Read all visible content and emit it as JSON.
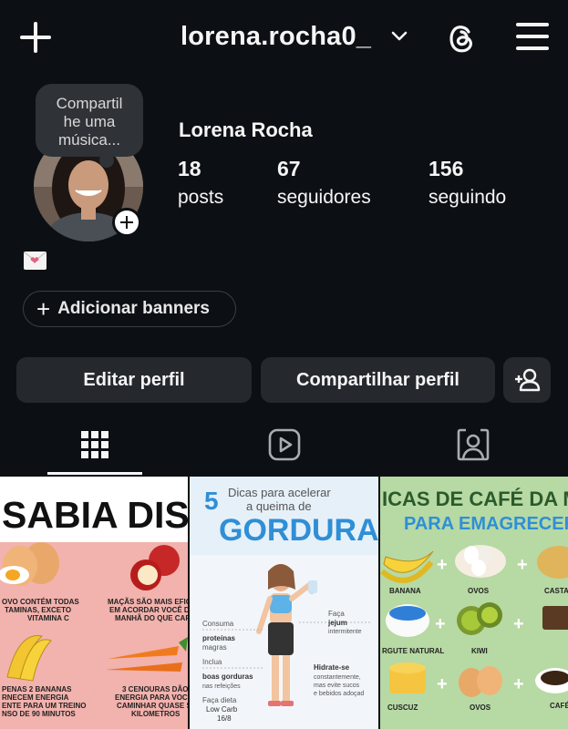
{
  "header": {
    "username": "lorena.rocha0_",
    "icons": [
      "plus-icon",
      "chevron-down-icon",
      "threads-icon",
      "menu-icon"
    ]
  },
  "profile": {
    "note": "Compartilhe uma música...",
    "note_line1": "Compartil",
    "note_line2": "he uma",
    "note_line3": "música...",
    "name": "Lorena Rocha",
    "stats": [
      {
        "value": "18",
        "label": "posts"
      },
      {
        "value": "67",
        "label": "seguidores"
      },
      {
        "value": "156",
        "label": "seguindo"
      }
    ],
    "bio_emoji": "envelope-with-heart"
  },
  "actions": {
    "banners": "Adicionar banners",
    "edit": "Editar perfil",
    "share": "Compartilhar perfil"
  },
  "tabs": [
    {
      "name": "grid",
      "active": true
    },
    {
      "name": "reels",
      "active": false
    },
    {
      "name": "tagged",
      "active": false
    }
  ],
  "posts": {
    "post1": {
      "title": "SABIA DISSO?",
      "text1": "OVO CONTÉM TODAS",
      "text2": "TAMINAS, EXCETO",
      "text3": "VITAMINA C",
      "text4": "MAÇÃS SÃO MAIS EFICA",
      "text5": "EM ACORDAR VOCÊ D",
      "text6": "MANHÃ DO QUE CAF",
      "text7": "PENAS 2 BANANAS",
      "text8": "RNECEM ENERGIA",
      "text9": "ENTE PARA UM TREINO",
      "text10": "NSO DE 90 MINUTOS",
      "text11": "3 CENOURAS DÃO",
      "text12": "ENERGIA PARA VOC",
      "text13": "CAMINHAR QUASE S",
      "text14": "KILOMETROS"
    },
    "post2": {
      "num": "5",
      "line1": "Dicas para acelerar",
      "line2": "a queima de",
      "big": "GORDURA",
      "tip1a": "Consuma",
      "tip1b": "proteínas",
      "tip1c": "magras",
      "tip2a": "Inclua",
      "tip2b": "boas gorduras",
      "tip2c": "nas refeições",
      "tip3a": "Faça dieta",
      "tip3b": "Low Carb",
      "tip3c": "16/8",
      "tip4a": "Faça",
      "tip4b": "jejum",
      "tip4c": "intermitente",
      "tip5a": "Hidrate-se",
      "tip5b": "constantemente,",
      "tip5c": "mas evite sucos",
      "tip5d": "e bebidos adoçad"
    },
    "post3": {
      "title1": "ICAS DE CAFÉ DA MANHÃ",
      "title2": "PARA EMAGRECER",
      "l1": "BANANA",
      "l2": "OVOS",
      "l3": "CASTA",
      "l4": "RGUTE NATURAL",
      "l5": "KIWI",
      "l6": "CUSCUZ",
      "l7": "OVOS",
      "l8": "CAFÉ"
    }
  },
  "colors": {
    "background": "#0c1014",
    "button": "#25292e",
    "post1_bg": "#f2b2ad",
    "post2_accent": "#2f8fd6",
    "post3_bg": "#b7d9a4"
  }
}
